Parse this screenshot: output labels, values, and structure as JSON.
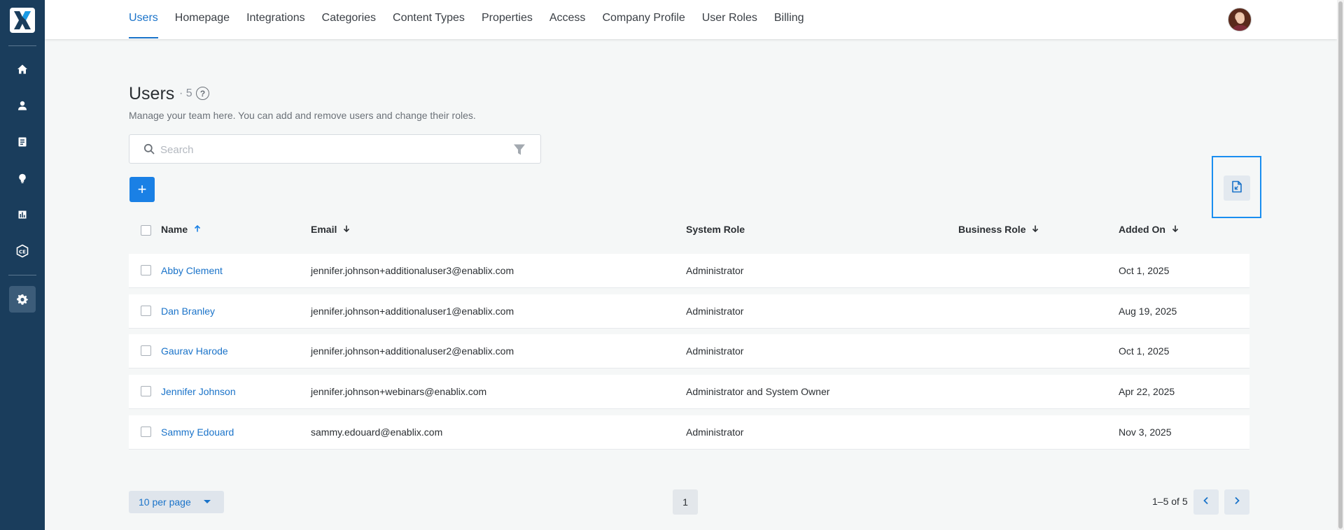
{
  "sidebar": {
    "icons": [
      "logo-icon",
      "home-icon",
      "user-icon",
      "document-icon",
      "lightbulb-icon",
      "bar-chart-icon",
      "ce-badge-icon",
      "gear-icon"
    ]
  },
  "tabs": [
    {
      "label": "Users",
      "active": true
    },
    {
      "label": "Homepage"
    },
    {
      "label": "Integrations"
    },
    {
      "label": "Categories"
    },
    {
      "label": "Content Types"
    },
    {
      "label": "Properties"
    },
    {
      "label": "Access"
    },
    {
      "label": "Company Profile"
    },
    {
      "label": "User Roles"
    },
    {
      "label": "Billing"
    }
  ],
  "page": {
    "title": "Users",
    "count": "· 5",
    "help": "?",
    "subtitle": "Manage your team here. You can add and remove users and change their roles."
  },
  "search": {
    "placeholder": "Search",
    "value": ""
  },
  "add_label": "+",
  "table": {
    "columns": [
      "Name",
      "Email",
      "System Role",
      "Business Role",
      "Added On"
    ],
    "rows": [
      {
        "name": "Abby Clement",
        "email": "jennifer.johnson+additionaluser3@enablix.com",
        "system_role": "Administrator",
        "business_role": "",
        "added_on": "Oct 1, 2025"
      },
      {
        "name": "Dan Branley",
        "email": "jennifer.johnson+additionaluser1@enablix.com",
        "system_role": "Administrator",
        "business_role": "",
        "added_on": "Aug 19, 2025"
      },
      {
        "name": "Gaurav Harode",
        "email": "jennifer.johnson+additionaluser2@enablix.com",
        "system_role": "Administrator",
        "business_role": "",
        "added_on": "Oct 1, 2025"
      },
      {
        "name": "Jennifer Johnson",
        "email": "jennifer.johnson+webinars@enablix.com",
        "system_role": "Administrator and System Owner",
        "business_role": "",
        "added_on": "Apr 22, 2025"
      },
      {
        "name": "Sammy Edouard",
        "email": "sammy.edouard@enablix.com",
        "system_role": "Administrator",
        "business_role": "",
        "added_on": "Nov 3, 2025"
      }
    ]
  },
  "pagination": {
    "per_page": "10 per page",
    "current_page": "1",
    "range": "1–5 of 5"
  },
  "colors": {
    "rail": "#1a3d5c",
    "accent": "#1a80e5",
    "link": "#1a73c9"
  }
}
